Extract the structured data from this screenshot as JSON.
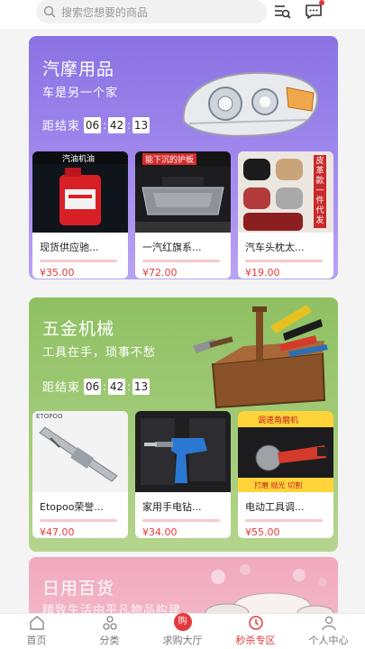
{
  "search": {
    "placeholder": "搜索您想要的商品"
  },
  "sections": {
    "auto": {
      "title": "汽摩用品",
      "subtitle": "车是另一个家",
      "countdown": {
        "label": "距结束",
        "h": "06",
        "m": "42",
        "s": "13"
      },
      "products": [
        {
          "name": "现货供应驰...",
          "price": "¥35.00",
          "img_text": "汽油机油"
        },
        {
          "name": "一汽红旗系...",
          "price": "¥72.00",
          "img_text": "能下沉的护板"
        },
        {
          "name": "汽车头枕太...",
          "price": "¥19.00",
          "img_text": "皮革款 一件代发"
        }
      ]
    },
    "hardware": {
      "title": "五金机械",
      "subtitle": "工具在手，琐事不愁",
      "countdown": {
        "label": "距结束",
        "h": "06",
        "m": "42",
        "s": "13"
      },
      "products": [
        {
          "name": "Etopoo荣誉...",
          "price": "¥47.00",
          "img_text": "ETOPOO"
        },
        {
          "name": "家用手电钻...",
          "price": "¥34.00",
          "img_text": ""
        },
        {
          "name": "电动工具调...",
          "price": "¥55.00",
          "img_text": "调速角磨机",
          "img_sub": "打磨 抛光 切割"
        }
      ]
    },
    "daily": {
      "title": "日用百货",
      "subtitle": "精致生活由平凡物品构建"
    }
  },
  "bottom_nav": [
    {
      "label": "首页",
      "icon": "home-icon"
    },
    {
      "label": "分类",
      "icon": "category-icon"
    },
    {
      "label": "求购大厅",
      "icon": "buy-icon",
      "badge": "购"
    },
    {
      "label": "秒杀专区",
      "icon": "flash-sale-icon",
      "active": true
    },
    {
      "label": "个人中心",
      "icon": "user-icon"
    }
  ],
  "colors": {
    "accent": "#e4393c",
    "auto_bg": "#8a72e3",
    "hardware_bg": "#8fc062",
    "daily_bg": "#f1a9bd"
  }
}
